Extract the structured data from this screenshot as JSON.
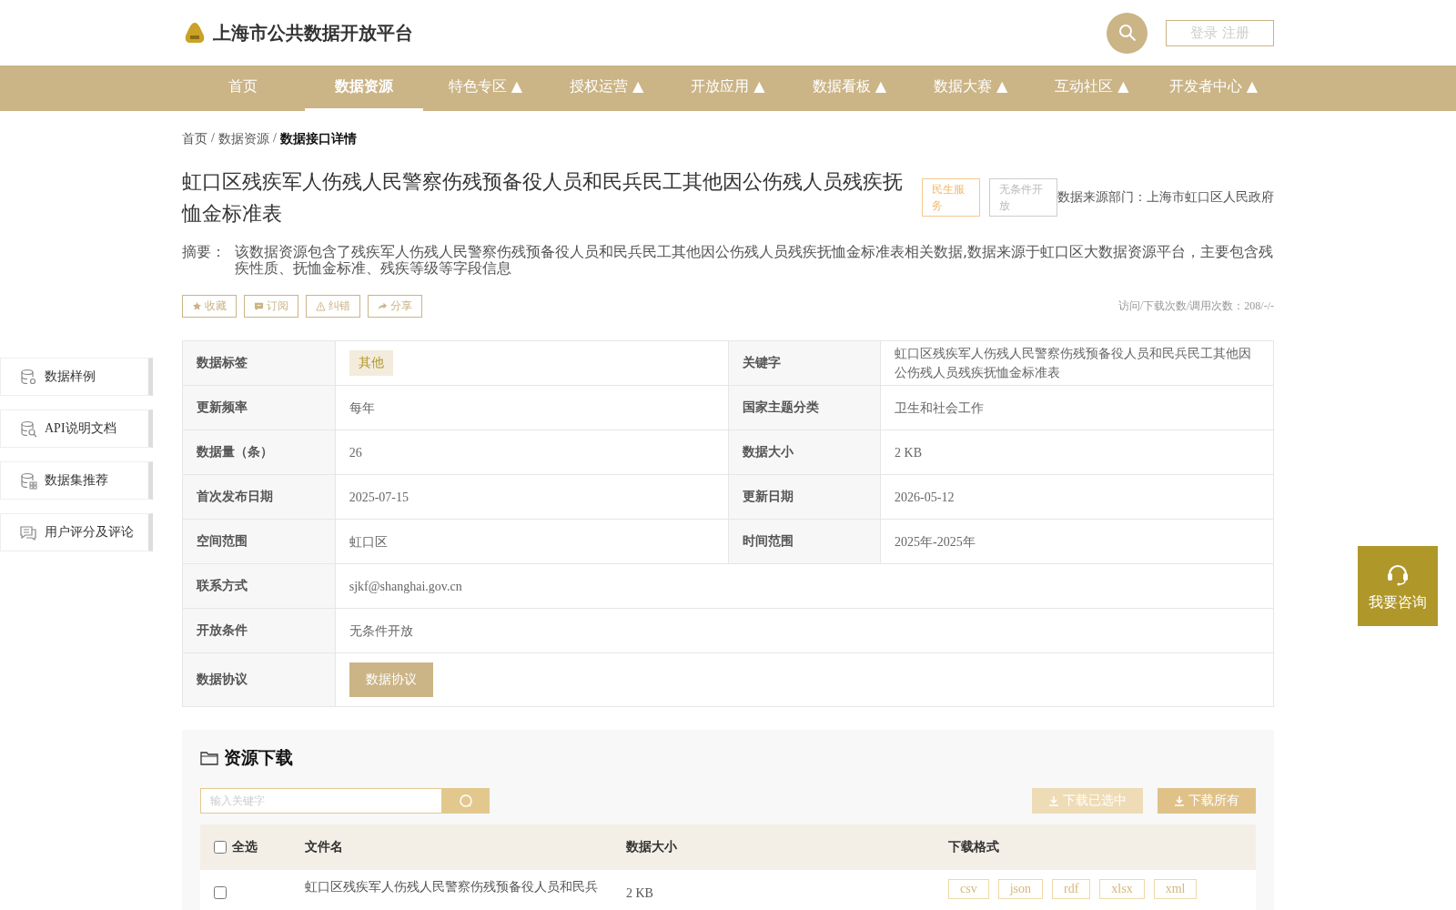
{
  "header": {
    "logo_text": "上海市公共数据开放平台",
    "login_button": "登录 注册"
  },
  "nav": [
    {
      "label": "首页",
      "selected": false
    },
    {
      "label": "数据资源",
      "selected": true
    },
    {
      "label": "特色专区 ▲",
      "selected": false
    },
    {
      "label": "授权运营 ▲",
      "selected": false
    },
    {
      "label": "开放应用 ▲",
      "selected": false
    },
    {
      "label": "数据看板 ▲",
      "selected": false
    },
    {
      "label": "数据大赛 ▲",
      "selected": false
    },
    {
      "label": "互动社区 ▲",
      "selected": false
    },
    {
      "label": "开发者中心 ▲",
      "selected": false
    }
  ],
  "breadcrumb": {
    "separator": "/",
    "items": [
      "首页",
      "数据资源",
      "数据接口详情"
    ]
  },
  "title": "虹口区残疾军人伤残人民警察伤残预备役人员和民兵民工其他因公伤残人员残疾抚恤金标准表",
  "tags": [
    {
      "label": "民生服务",
      "kind": "service"
    },
    {
      "label": "无条件开放",
      "kind": "open"
    }
  ],
  "source": "数据来源部门：上海市虹口区人民政府",
  "summary": {
    "label": "摘要：",
    "text": "该数据资源包含了残疾军人伤残人民警察伤残预备役人员和民兵民工其他因公伤残人员残疾抚恤金标准表相关数据,数据来源于虹口区大数据资源平台，主要包含残疾性质、抚恤金标准、残疾等级等字段信息"
  },
  "actions": [
    {
      "label": "收藏",
      "kind": "star"
    },
    {
      "label": "订阅",
      "kind": "message"
    },
    {
      "label": "纠错",
      "kind": "warning"
    },
    {
      "label": "分享",
      "kind": "share"
    }
  ],
  "stats": "访问/下载次数/调用次数：208/-/-",
  "info_rows": [
    [
      {
        "label": "数据标签",
        "value": "其他",
        "kind": "tag"
      },
      {
        "label": "关键字",
        "value": "虹口区残疾军人伤残人民警察伤残预备役人员和民兵民工其他因公伤残人员残疾抚恤金标准表",
        "kind": "text"
      }
    ],
    [
      {
        "label": "更新频率",
        "value": "每年",
        "kind": "text"
      },
      {
        "label": "国家主题分类",
        "value": "卫生和社会工作",
        "kind": "text"
      }
    ],
    [
      {
        "label": "数据量（条）",
        "value": "26",
        "kind": "text"
      },
      {
        "label": "数据大小",
        "value": "2 KB",
        "kind": "text"
      }
    ],
    [
      {
        "label": "首次发布日期",
        "value": "2025-07-15",
        "kind": "text"
      },
      {
        "label": "更新日期",
        "value": "2026-05-12",
        "kind": "text"
      }
    ],
    [
      {
        "label": "空间范围",
        "value": "虹口区",
        "kind": "text"
      },
      {
        "label": "时间范围",
        "value": "2025年-2025年",
        "kind": "text"
      }
    ],
    [
      {
        "label": "联系方式",
        "value": "sjkf@shanghai.gov.cn",
        "kind": "text"
      }
    ],
    [
      {
        "label": "开放条件",
        "value": "无条件开放",
        "kind": "text"
      }
    ],
    [
      {
        "label": "数据协议",
        "value": "数据协议",
        "kind": "button"
      }
    ]
  ],
  "sidebar": [
    {
      "label": "数据样例",
      "kind": "samples"
    },
    {
      "label": "API说明文档",
      "kind": "docs"
    },
    {
      "label": "数据集推荐",
      "kind": "recommend"
    },
    {
      "label": "用户评分及评论",
      "kind": "reviews"
    }
  ],
  "download": {
    "title": "资源下载",
    "search": {
      "placeholder": "输入关键字"
    },
    "buttons": [
      {
        "label": "下载已选中",
        "disabled": true
      },
      {
        "label": "下载所有",
        "disabled": false
      }
    ],
    "select_all": {
      "label": "全选",
      "checked": false
    },
    "columns": [
      "文件名",
      "数据大小",
      "下载格式"
    ],
    "rows": [
      {
        "checked": false,
        "name": "虹口区残疾军人伤残人民警察伤残预备役人员和民兵",
        "size": "2 KB",
        "formats": [
          "csv",
          "json",
          "rdf",
          "xlsx",
          "xml"
        ]
      }
    ]
  },
  "consult": {
    "label": "我要咨询"
  }
}
